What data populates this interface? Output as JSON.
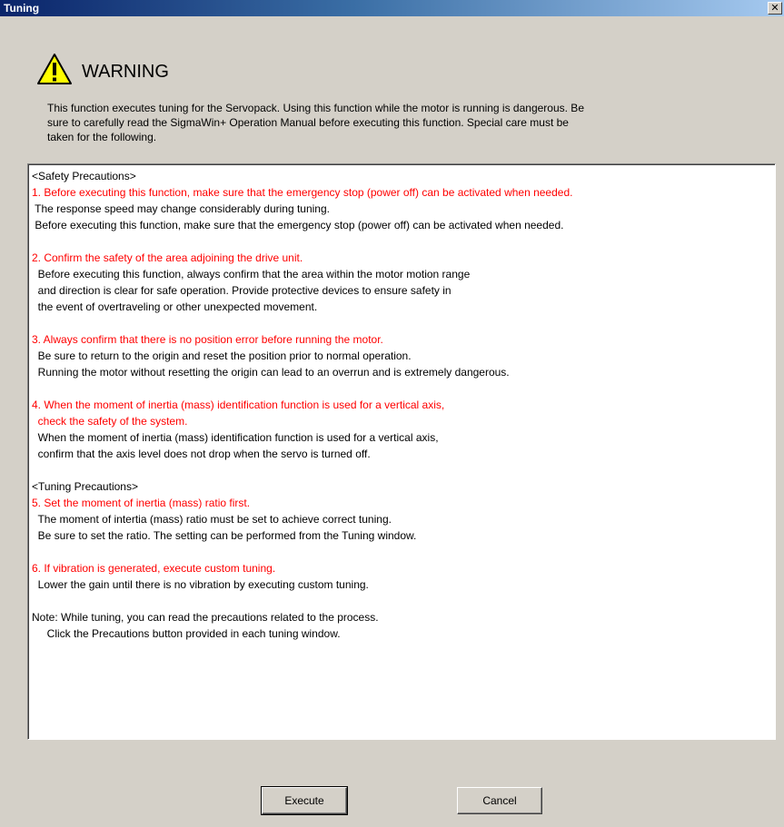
{
  "window": {
    "title": "Tuning",
    "close_label": "✕"
  },
  "warning": {
    "icon": "warning-triangle-icon",
    "title": "WARNING",
    "intro": [
      "This function executes tuning for the Servopack. Using this function while the motor is running is dangerous. Be",
      "sure to carefully read the SigmaWin+ Operation Manual before executing this function. Special care must be",
      "taken for the following."
    ]
  },
  "precautions": {
    "lines": [
      {
        "text": "<Safety Precautions>",
        "red": false
      },
      {
        "text": "1. Before executing this function, make sure that the emergency stop (power off) can be activated when needed.",
        "red": true
      },
      {
        "text": " The response speed may change considerably during tuning.",
        "red": false
      },
      {
        "text": " Before executing this function, make sure that the emergency stop (power off) can be activated when needed.",
        "red": false
      },
      {
        "text": "",
        "red": false
      },
      {
        "text": "2. Confirm the safety of the area adjoining the drive unit.",
        "red": true
      },
      {
        "text": "  Before executing this function, always confirm that the area within the motor motion range",
        "red": false
      },
      {
        "text": "  and direction is clear for safe operation. Provide protective devices to ensure safety in",
        "red": false
      },
      {
        "text": "  the event of overtraveling or other unexpected movement.",
        "red": false
      },
      {
        "text": "",
        "red": false
      },
      {
        "text": "3. Always confirm that there is no position error before running the motor.",
        "red": true
      },
      {
        "text": "  Be sure to return to the origin and reset the position prior to normal operation.",
        "red": false
      },
      {
        "text": "  Running the motor without resetting the origin can lead to an overrun and is extremely dangerous.",
        "red": false
      },
      {
        "text": "",
        "red": false
      },
      {
        "text": "4. When the moment of inertia (mass) identification function is used for a vertical axis,",
        "red": true
      },
      {
        "text": "  check the safety of the system.",
        "red": true
      },
      {
        "text": "  When the moment of inertia (mass) identification function is used for a vertical axis,",
        "red": false
      },
      {
        "text": "  confirm that the axis level does not drop when the servo is turned off.",
        "red": false
      },
      {
        "text": "",
        "red": false
      },
      {
        "text": "<Tuning Precautions>",
        "red": false
      },
      {
        "text": "5. Set the moment of inertia (mass) ratio first.",
        "red": true
      },
      {
        "text": "  The moment of intertia (mass) ratio must be set to achieve correct tuning.",
        "red": false
      },
      {
        "text": "  Be sure to set the ratio. The setting can be performed from the Tuning window.",
        "red": false
      },
      {
        "text": "",
        "red": false
      },
      {
        "text": "6. If vibration is generated, execute custom tuning.",
        "red": true
      },
      {
        "text": "  Lower the gain until there is no vibration by executing custom tuning.",
        "red": false
      },
      {
        "text": "",
        "red": false
      },
      {
        "text": "Note: While tuning, you can read the precautions related to the process.",
        "red": false
      },
      {
        "text": "     Click the Precautions button provided in each tuning window.",
        "red": false
      }
    ]
  },
  "buttons": {
    "execute": "Execute",
    "cancel": "Cancel"
  },
  "colors": {
    "accent_red": "#ff0000",
    "title_bar": "#0a246a",
    "dialog_bg": "#d4d0c8"
  }
}
